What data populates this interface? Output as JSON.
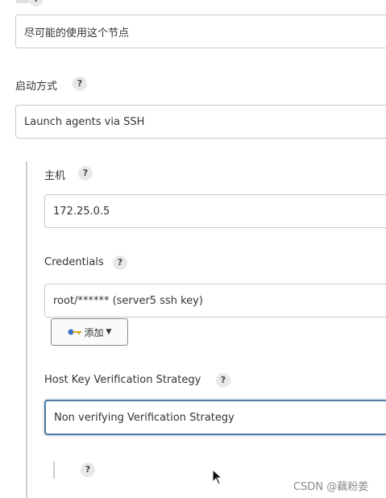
{
  "usage": {
    "value": "尽可能的使用这个节点"
  },
  "launch_method": {
    "label": "启动方式",
    "value": "Launch agents via SSH"
  },
  "host": {
    "label": "主机",
    "value": "172.25.0.5"
  },
  "credentials": {
    "label": "Credentials",
    "value": "root/****** (server5 ssh key)",
    "add_button": "添加"
  },
  "host_key": {
    "label": "Host Key Verification Strategy",
    "value": "Non verifying Verification Strategy"
  },
  "help_glyph": "?",
  "watermark": "CSDN @藕粉姜",
  "colors": {
    "focus_border": "#4f7ba3",
    "key_icon": "#3a6fd0"
  }
}
